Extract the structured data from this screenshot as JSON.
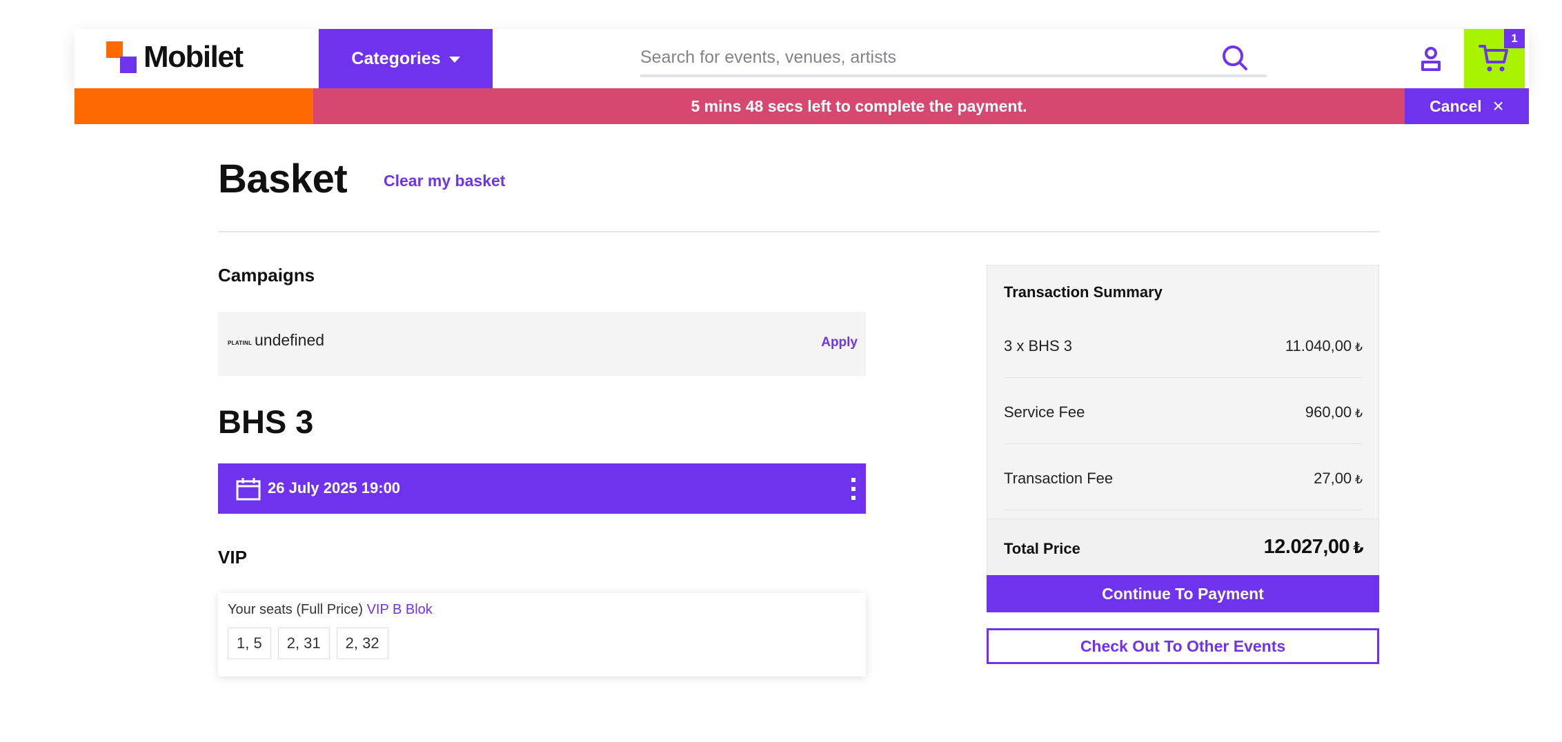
{
  "header": {
    "logo_text": "Mobilet",
    "categories_label": "Categories",
    "search_placeholder": "Search for events, venues, artists",
    "cart_count": "1",
    "icons": [
      "logo-icon",
      "chevron-down-icon",
      "search-icon",
      "user-icon",
      "cart-icon"
    ]
  },
  "timer": {
    "message": "5 mins 48 secs left to complete the payment.",
    "cancel_label": "Cancel",
    "cancel_icon": "close-icon",
    "colors": {
      "progress": "#ff6a00",
      "bar": "#d64870",
      "cancel": "#6f33ee"
    }
  },
  "basket": {
    "title": "Basket",
    "clear_label": "Clear my basket"
  },
  "campaigns": {
    "title": "Campaigns",
    "logo_text": "PLATINL",
    "name": "undefined",
    "apply_label": "Apply"
  },
  "event": {
    "title": "BHS 3",
    "date": "26 July 2025 19:00",
    "ticket_type": "VIP",
    "seats_prefix": "Your seats (Full Price)",
    "seats_block": "VIP B Blok",
    "seats": [
      "1, 5",
      "2, 31",
      "2, 32"
    ]
  },
  "summary": {
    "title": "Transaction Summary",
    "currency": "₺",
    "rows": [
      {
        "label": "3 x BHS 3",
        "value": "11.040,00"
      },
      {
        "label": "Service Fee",
        "value": "960,00"
      },
      {
        "label": "Transaction Fee",
        "value": "27,00"
      }
    ],
    "total_label": "Total Price",
    "total_value": "12.027,00"
  },
  "actions": {
    "continue_label": "Continue To Payment",
    "checkout_label": "Check Out To Other Events"
  },
  "colors": {
    "accent": "#6f33ee",
    "brand_orange": "#ff6a00",
    "cart_green": "#a8f400"
  }
}
